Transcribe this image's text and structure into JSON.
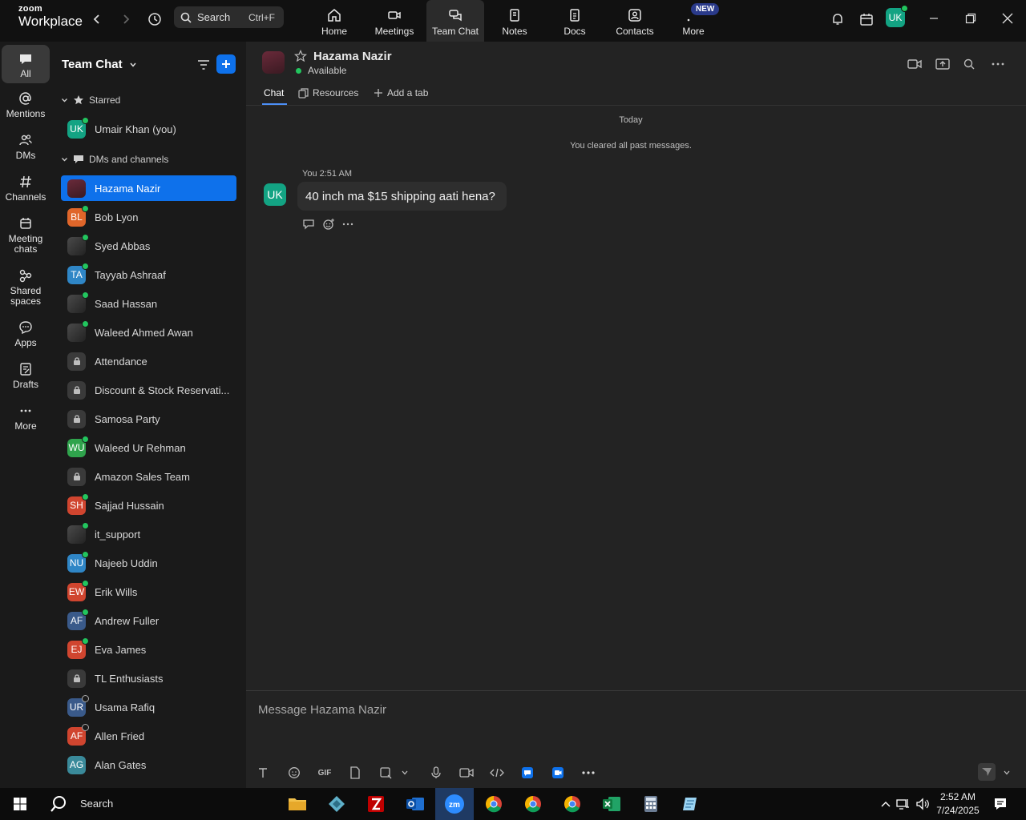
{
  "app": {
    "logo_small": "zoom",
    "logo_big": "Workplace"
  },
  "search": {
    "label": "Search",
    "shortcut": "Ctrl+F"
  },
  "nav": {
    "items": [
      {
        "label": "Home",
        "icon": "home-icon"
      },
      {
        "label": "Meetings",
        "icon": "video-icon"
      },
      {
        "label": "Team Chat",
        "icon": "chat-icon",
        "active": true
      },
      {
        "label": "Notes",
        "icon": "notes-icon"
      },
      {
        "label": "Docs",
        "icon": "docs-icon"
      },
      {
        "label": "Contacts",
        "icon": "contacts-icon"
      },
      {
        "label": "More",
        "icon": "more-icon"
      }
    ],
    "new_badge": "NEW"
  },
  "user": {
    "initials": "UK"
  },
  "rail": {
    "items": [
      {
        "label": "All",
        "icon": "chat-bubble-icon",
        "active": true
      },
      {
        "label": "Mentions",
        "icon": "at-icon"
      },
      {
        "label": "DMs",
        "icon": "people-icon"
      },
      {
        "label": "Channels",
        "icon": "hash-icon"
      },
      {
        "label": "Meeting chats",
        "icon": "calendar-icon"
      },
      {
        "label": "Shared spaces",
        "icon": "shared-spaces-icon"
      },
      {
        "label": "Apps",
        "icon": "apps-icon"
      },
      {
        "label": "Drafts",
        "icon": "drafts-icon"
      },
      {
        "label": "More",
        "icon": "more-dots-icon"
      }
    ]
  },
  "sidebar": {
    "title": "Team Chat",
    "starred_label": "Starred",
    "starred": [
      {
        "name": "Umair Khan (you)",
        "initials": "UK",
        "color": "#13a383",
        "status": "online"
      }
    ],
    "dms_label": "DMs and channels",
    "items": [
      {
        "name": "Hazama Nazir",
        "type": "photo",
        "selected": true
      },
      {
        "name": "Bob Lyon",
        "initials": "BL",
        "color": "#e0662a",
        "status": "online"
      },
      {
        "name": "Syed Abbas",
        "type": "photo",
        "status": "online"
      },
      {
        "name": "Tayyab Ashraaf",
        "initials": "TA",
        "color": "#2f86c6",
        "status": "online"
      },
      {
        "name": "Saad Hassan",
        "type": "photo",
        "status": "online"
      },
      {
        "name": "Waleed Ahmed Awan",
        "type": "photo",
        "status": "online"
      },
      {
        "name": "Attendance",
        "type": "lock"
      },
      {
        "name": "Discount & Stock Reservati...",
        "type": "lock"
      },
      {
        "name": "Samosa Party",
        "type": "lock"
      },
      {
        "name": "Waleed Ur Rehman",
        "initials": "WU",
        "color": "#2fa34c",
        "status": "online"
      },
      {
        "name": "Amazon Sales Team",
        "type": "lock"
      },
      {
        "name": "Sajjad Hussain",
        "initials": "SH",
        "color": "#d0452f",
        "status": "online"
      },
      {
        "name": "it_support",
        "type": "photo",
        "status": "online"
      },
      {
        "name": "Najeeb Uddin",
        "initials": "NU",
        "color": "#2f86c6",
        "status": "online"
      },
      {
        "name": "Erik Wills",
        "initials": "EW",
        "color": "#d0452f",
        "status": "online"
      },
      {
        "name": "Andrew Fuller",
        "initials": "AF",
        "color": "#3a5a8a",
        "status": "online"
      },
      {
        "name": "Eva James",
        "initials": "EJ",
        "color": "#d0452f",
        "status": "online"
      },
      {
        "name": "TL Enthusiasts",
        "type": "lock"
      },
      {
        "name": "Usama Rafiq",
        "initials": "UR",
        "color": "#3a5a8a",
        "status": "offline"
      },
      {
        "name": "Allen Fried",
        "initials": "AF",
        "color": "#d0452f",
        "status": "offline"
      },
      {
        "name": "Alan Gates",
        "initials": "AG",
        "color": "#3a8a9a"
      }
    ]
  },
  "chat": {
    "contact_name": "Hazama Nazir",
    "status": "Available",
    "tabs": [
      {
        "label": "Chat",
        "active": true
      },
      {
        "label": "Resources"
      },
      {
        "label": "Add a tab"
      }
    ],
    "day_divider": "Today",
    "system_message": "You cleared all past messages.",
    "messages": [
      {
        "sender": "You",
        "time": "2:51 AM",
        "text": "40 inch ma $15 shipping aati hena?",
        "initials": "UK"
      }
    ],
    "composer_placeholder": "Message Hazama Nazir",
    "gif_label": "GIF"
  },
  "taskbar": {
    "search_label": "Search",
    "time": "2:52 AM",
    "date": "7/24/2025"
  }
}
